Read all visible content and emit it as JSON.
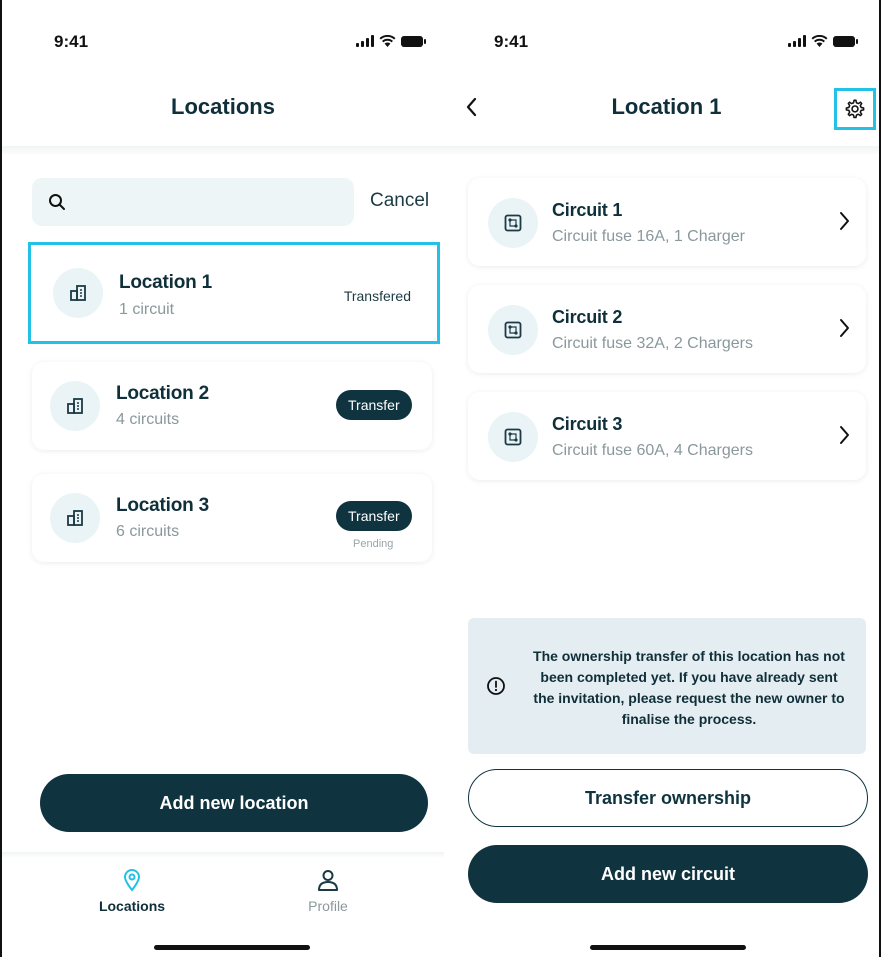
{
  "status": {
    "time": "9:41"
  },
  "left": {
    "title": "Locations",
    "search": {
      "placeholder": "",
      "cancel_label": "Cancel"
    },
    "locations": [
      {
        "name": "Location 1",
        "circuits": "1 circuit",
        "status_text": "Transfered"
      },
      {
        "name": "Location 2",
        "circuits": "4 circuits",
        "action_label": "Transfer"
      },
      {
        "name": "Location 3",
        "circuits": "6 circuits",
        "action_label": "Transfer",
        "status_text": "Pending"
      }
    ],
    "add_button": "Add new location",
    "tabs": [
      {
        "label": "Locations",
        "icon": "location-pin-icon",
        "active": true
      },
      {
        "label": "Profile",
        "icon": "person-icon",
        "active": false
      }
    ]
  },
  "right": {
    "title": "Location 1",
    "circuits": [
      {
        "name": "Circuit 1",
        "detail": "Circuit fuse 16A, 1 Charger"
      },
      {
        "name": "Circuit 2",
        "detail": "Circuit fuse 32A, 2 Chargers"
      },
      {
        "name": "Circuit 3",
        "detail": "Circuit fuse 60A, 4 Chargers"
      }
    ],
    "notice": "The ownership transfer of this location has not been completed yet. If you have already sent the invitation, please request the new owner to finalise the process.",
    "transfer_button": "Transfer ownership",
    "add_button": "Add new circuit"
  },
  "colors": {
    "primary": "#0f3440",
    "highlight": "#23c1e6",
    "notice_bg": "#e4eef2",
    "icon_bg": "#eaf4f6"
  }
}
